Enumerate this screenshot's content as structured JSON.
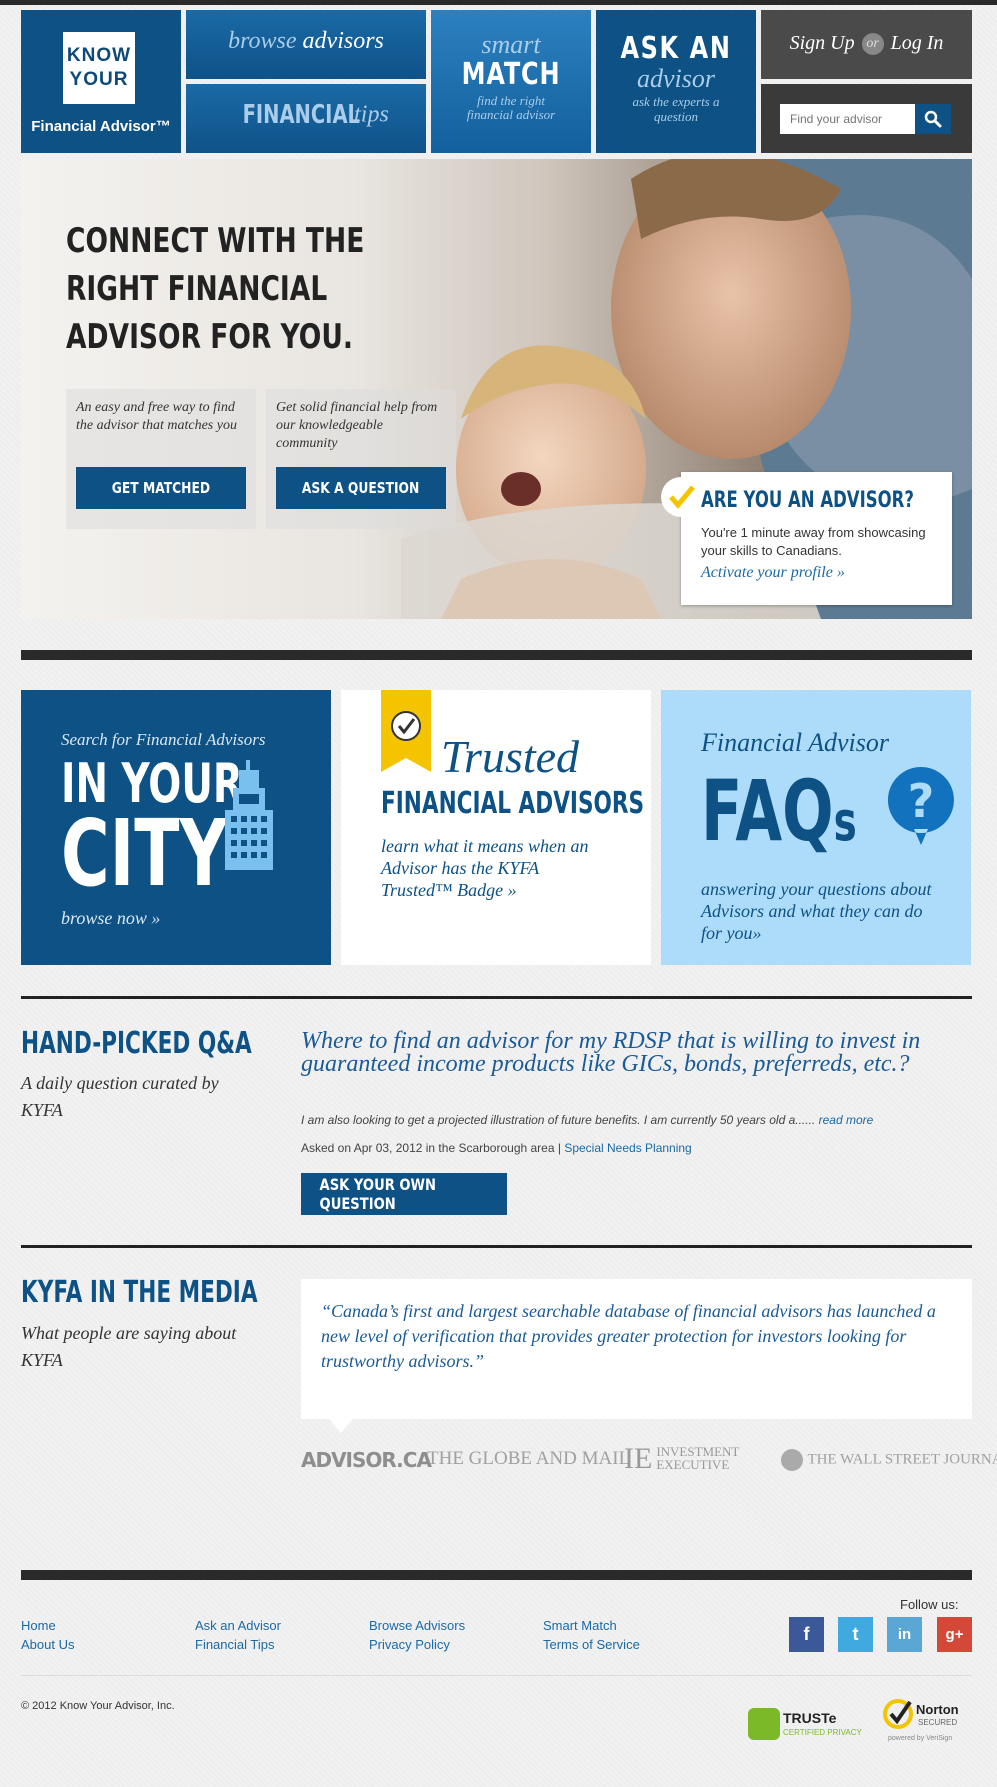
{
  "header": {
    "logo": {
      "line1": "KNOW",
      "line2": "YOUR",
      "name": "Financial Advisor™"
    },
    "browse": {
      "word1": "browse",
      "word2": "advisors"
    },
    "tips": {
      "word1": "FINANCIAL",
      "word2": "tips"
    },
    "match": {
      "word1": "smart",
      "word2": "MATCH",
      "sub": "find the right financial advisor"
    },
    "ask": {
      "word1": "ASK AN",
      "word2": "advisor",
      "sub": "ask the experts a question"
    },
    "auth": {
      "signup": "Sign Up",
      "or": "or",
      "login": "Log In"
    },
    "search": {
      "placeholder": "Find your advisor"
    }
  },
  "hero": {
    "headline": "CONNECT WITH THE RIGHT FINANCIAL ADVISOR FOR YOU.",
    "card1": {
      "text": "An easy and free way to find the advisor that matches you",
      "button": "GET MATCHED"
    },
    "card2": {
      "text": "Get solid financial help from our knowledgeable community",
      "button": "ASK A QUESTION"
    },
    "advisor": {
      "title": "ARE YOU AN ADVISOR?",
      "text": "You're 1 minute away from showcasing your skills to Canadians.",
      "link": "Activate your profile »"
    }
  },
  "features": {
    "city": {
      "lead": "Search for Financial Advisors",
      "line1": "IN YOUR",
      "line2": "CITY",
      "link": "browse now »"
    },
    "trusted": {
      "word1": "Trusted",
      "word2": "FINANCIAL ADVISORS",
      "text": "learn what it means when an Advisor has the KYFA Trusted™ Badge »"
    },
    "faq": {
      "lead": "Financial Advisor",
      "big": "FAQ",
      "small": "s",
      "text": "answering your questions about Advisors and what they can do for you»"
    }
  },
  "qa": {
    "heading": "HAND-PICKED Q&A",
    "sub": "A daily question curated by KYFA",
    "question": "Where to find an advisor for my RDSP that is willing to invest in guaranteed income products like GICs, bonds, preferreds, etc.?",
    "excerpt": "I am also looking to get a projected illustration of future benefits. I am currently 50 years old a......",
    "read_more": "read more",
    "meta": "Asked on Apr 03, 2012 in the Scarborough area |",
    "category": "Special Needs Planning",
    "button": "ASK YOUR OWN QUESTION"
  },
  "media": {
    "heading": "KYFA IN THE MEDIA",
    "sub": "What people are saying about KYFA",
    "quote": "“Canada’s first and largest searchable database of financial advisors has launched a new level of verification that provides greater protection for investors looking for trustworthy advisors.”",
    "logos": [
      "ADVISOR.CA",
      "THE GLOBE AND MAIL",
      "INVESTMENT EXECUTIVE",
      "THE WALL STREET JOURNAL"
    ]
  },
  "footer": {
    "follow": "Follow us:",
    "links": [
      "Home",
      "About Us",
      "Ask an Advisor",
      "Financial Tips",
      "Browse Advisors",
      "Privacy Policy",
      "Smart Match",
      "Terms of Service"
    ],
    "copyright": "© 2012 Know Your Advisor, Inc.",
    "badges": {
      "truste": "TRUSTe",
      "truste_sub": "CERTIFIED PRIVACY",
      "norton": "Norton",
      "norton_sub": "SECURED",
      "verisign": "powered by VeriSign"
    },
    "social": [
      "f",
      "t",
      "in",
      "g+"
    ]
  },
  "colors": {
    "brand": "#0d5185",
    "accent_light": "#addcfa",
    "link": "#1a6aa6",
    "check": "#f5c400"
  }
}
